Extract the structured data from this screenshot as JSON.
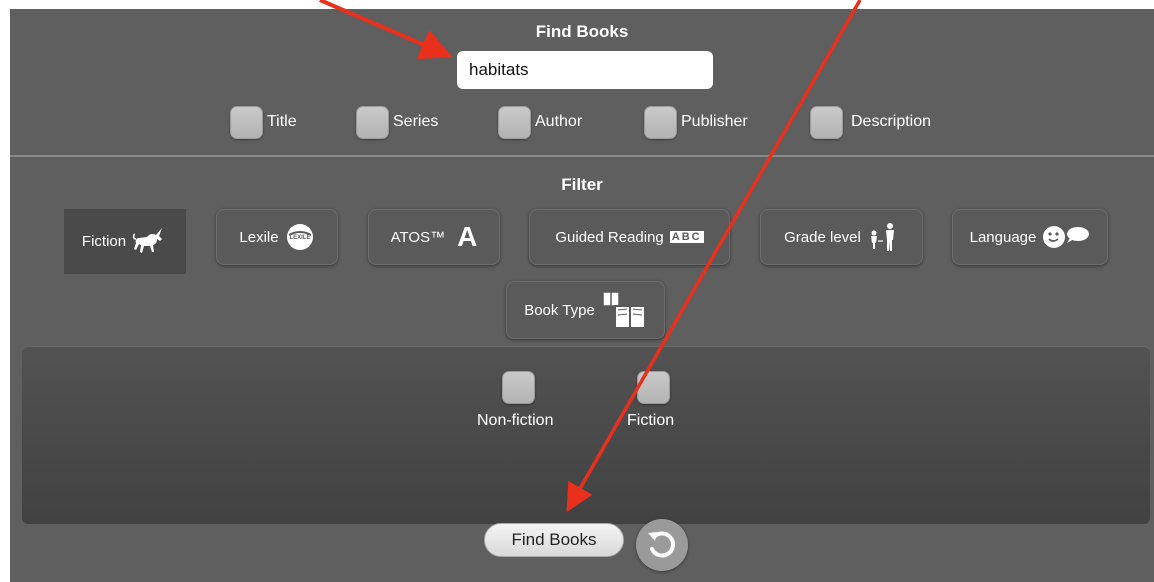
{
  "find_section": {
    "title": "Find Books",
    "search_value": "habitats",
    "search_fields": [
      {
        "label": "Title"
      },
      {
        "label": "Series"
      },
      {
        "label": "Author"
      },
      {
        "label": "Publisher"
      },
      {
        "label": "Description"
      }
    ]
  },
  "filter_section": {
    "title": "Filter",
    "chips": [
      {
        "label": "Fiction",
        "icon": "unicorn-icon",
        "active": true
      },
      {
        "label": "Lexile",
        "icon": "lexile-logo-icon",
        "icon_text": "LEXILE"
      },
      {
        "label": "ATOS™",
        "icon": "letter-a-icon",
        "icon_text": "A"
      },
      {
        "label": "Guided Reading",
        "icon": "abc-blocks-icon",
        "icon_text": "ABC"
      },
      {
        "label": "Grade level",
        "icon": "child-adult-icon"
      },
      {
        "label": "Language",
        "icon": "smiley-speech-icon"
      },
      {
        "label": "Book Type",
        "icon": "books-icon"
      }
    ],
    "fiction_options": [
      {
        "label": "Non-fiction"
      },
      {
        "label": "Fiction"
      }
    ]
  },
  "actions": {
    "find_label": "Find Books",
    "reset_icon": "reset-icon"
  },
  "colors": {
    "panel_bg": "#5f5f5f",
    "annotation_arrow": "#e8301c"
  }
}
